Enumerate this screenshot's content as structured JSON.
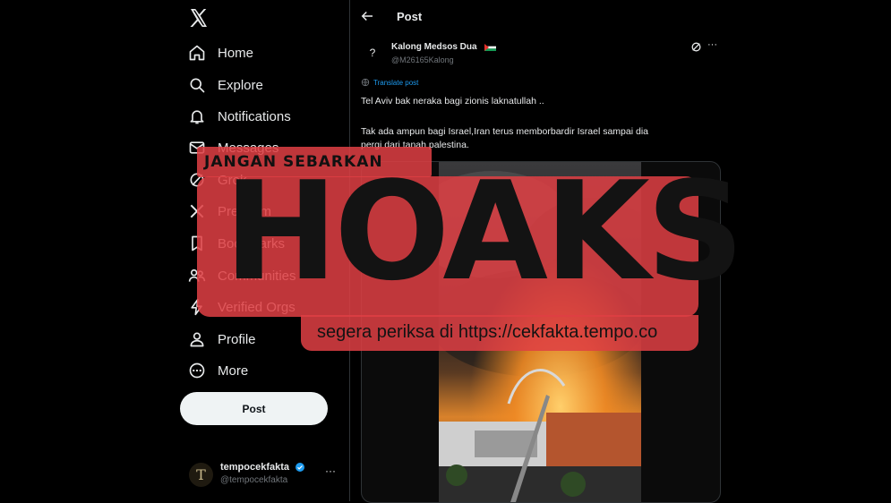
{
  "sidebar": {
    "items": [
      {
        "label": "Home",
        "icon": "home-icon"
      },
      {
        "label": "Explore",
        "icon": "search-icon"
      },
      {
        "label": "Notifications",
        "icon": "bell-icon"
      },
      {
        "label": "Messages",
        "icon": "envelope-icon"
      },
      {
        "label": "Grok",
        "icon": "grok-icon"
      },
      {
        "label": "Premium",
        "icon": "x-logo-icon"
      },
      {
        "label": "Bookmarks",
        "icon": "bookmark-icon"
      },
      {
        "label": "Communities",
        "icon": "people-icon"
      },
      {
        "label": "Verified Orgs",
        "icon": "lightning-icon"
      },
      {
        "label": "Profile",
        "icon": "person-icon"
      },
      {
        "label": "More",
        "icon": "more-circle-icon"
      }
    ],
    "post_button": "Post",
    "account": {
      "name": "tempocekfakta",
      "handle": "@tempocekfakta",
      "avatar_letter": "T",
      "more": "···"
    }
  },
  "main": {
    "header_title": "Post",
    "tweet": {
      "author_name": "Kalong Medsos Dua",
      "author_handle": "@M26165Kalong",
      "avatar_placeholder": "?",
      "more": "···",
      "translate_label": "Translate post",
      "text_lines": [
        "Tel Aviv bak neraka bagi zionis laknatullah ..",
        "Tak ada ampun bagi Israel,Iran terus memborbardir Israel sampai dia",
        "pergi dari tanah palestina."
      ]
    }
  },
  "overlay": {
    "top_text": "JANGAN SEBARKAN",
    "big_text": "HOAKS",
    "url_text": "segera periksa di https://cekfakta.tempo.co"
  },
  "colors": {
    "background": "#000000",
    "text": "#e7e9ea",
    "muted": "#71767b",
    "link": "#1d9bf0",
    "banner_red": "#de3f43",
    "verified": "#1d9bf0"
  }
}
